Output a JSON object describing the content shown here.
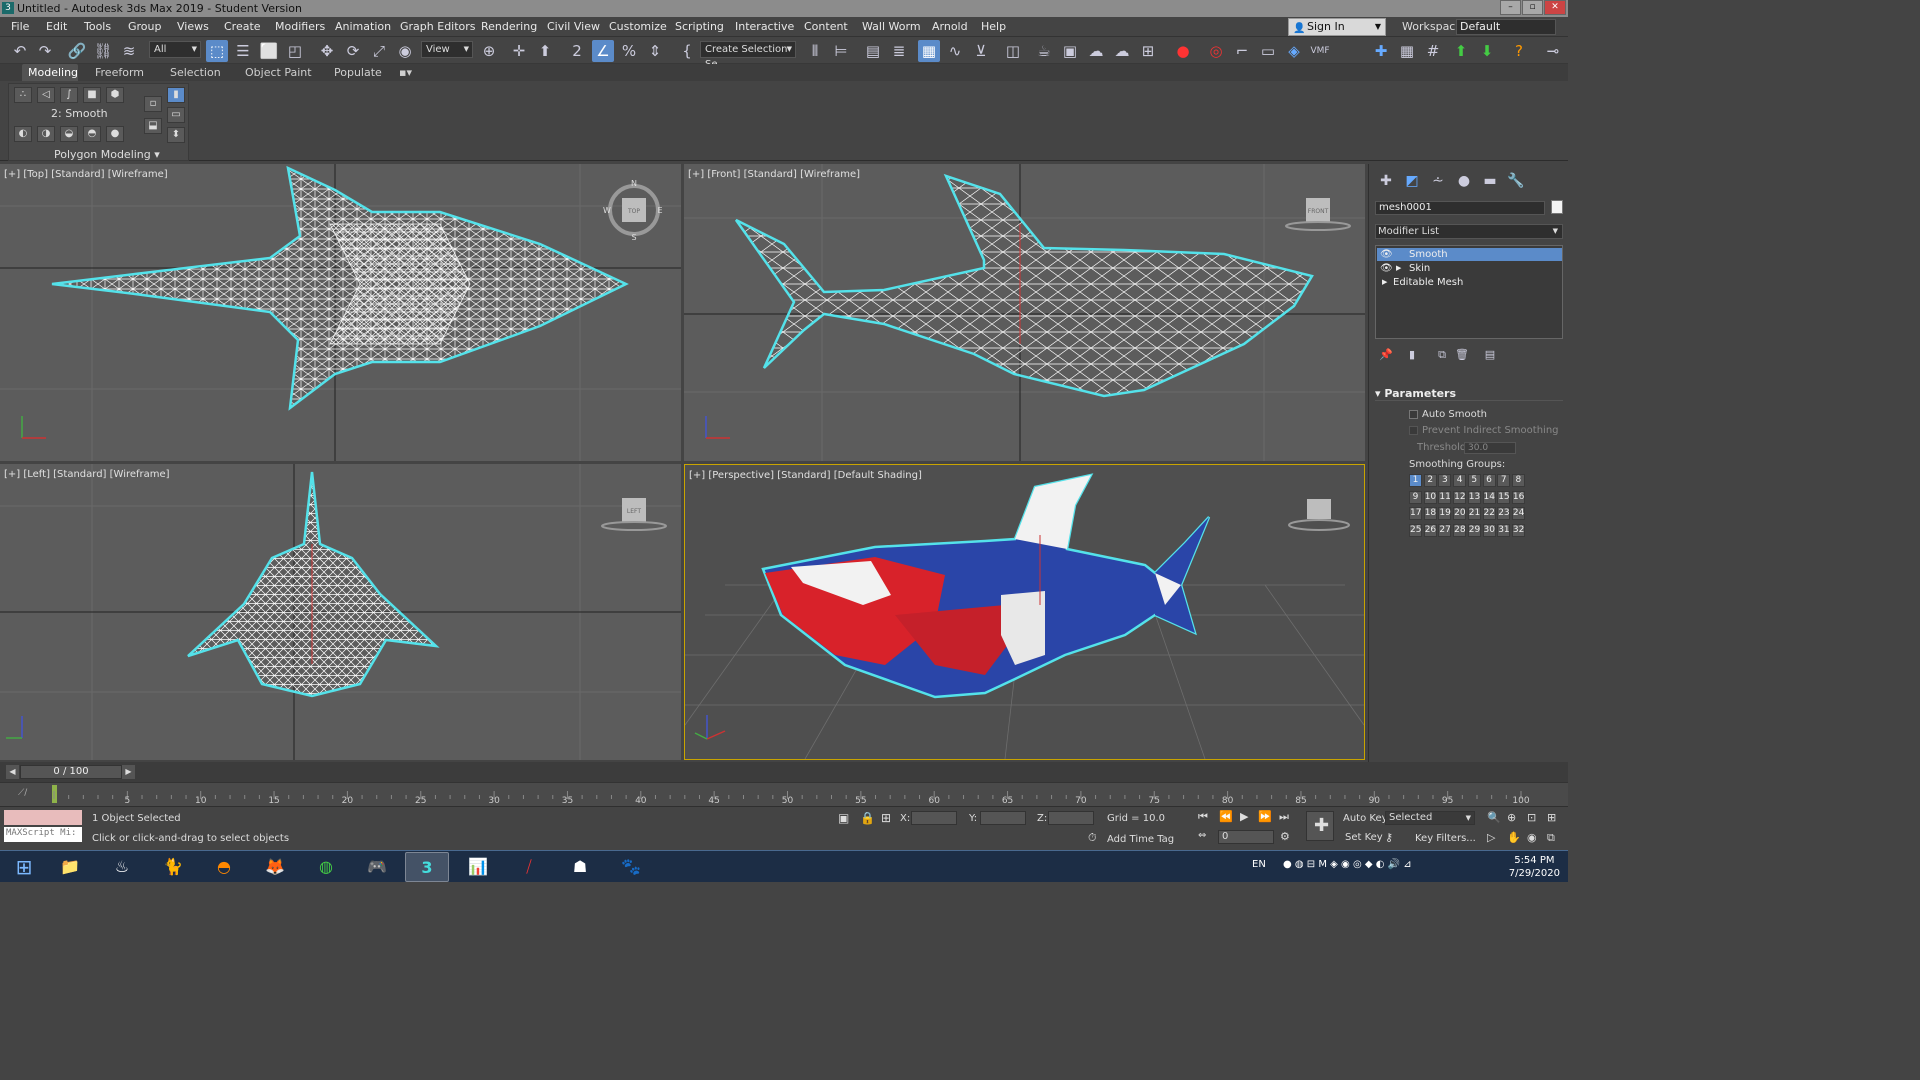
{
  "window": {
    "title": "Untitled - Autodesk 3ds Max 2019 - Student Version"
  },
  "menu": [
    "File",
    "Edit",
    "Tools",
    "Group",
    "Views",
    "Create",
    "Modifiers",
    "Animation",
    "Graph Editors",
    "Rendering",
    "Civil View",
    "Customize",
    "Scripting",
    "Interactive",
    "Content",
    "Wall Worm",
    "Arnold",
    "Help"
  ],
  "account": {
    "sign_in": "Sign In",
    "workspaces_label": "Workspaces:",
    "workspace": "Default"
  },
  "toolbar": {
    "filter": "All",
    "refcoord": "View",
    "selection_set": "Create Selection Se"
  },
  "ribbon": {
    "tabs": [
      "Modeling",
      "Freeform",
      "Selection",
      "Object Paint",
      "Populate"
    ],
    "level": "2: Smooth",
    "panel": "Polygon Modeling"
  },
  "viewports": {
    "top": "[+] [Top] [Standard] [Wireframe]",
    "front": "[+] [Front] [Standard] [Wireframe]",
    "left": "[+] [Left] [Standard] [Wireframe]",
    "perspective": "[+] [Perspective] [Standard] [Default Shading]"
  },
  "viewcube": {
    "top": "TOP",
    "front": "FRONT",
    "left": "LEFT",
    "n": "N",
    "s": "S",
    "e": "E",
    "w": "W"
  },
  "colors": {
    "selection": "#54e2ea",
    "accent": "#5b8bc9",
    "shark_blue": "#2a45a8",
    "shark_red": "#d8222a",
    "shark_white": "#f2f2f2",
    "active_border": "#c9a400"
  },
  "command_panel": {
    "object_name": "mesh0001",
    "modifier_list": "Modifier List",
    "stack": [
      "Smooth",
      "Skin",
      "Editable Mesh"
    ],
    "rollout": "Parameters",
    "auto_smooth": "Auto Smooth",
    "prevent": "Prevent Indirect Smoothing",
    "threshold_label": "Threshold:",
    "threshold_value": "30.0",
    "groups_label": "Smoothing Groups:",
    "groups": [
      "1",
      "2",
      "3",
      "4",
      "5",
      "6",
      "7",
      "8",
      "9",
      "10",
      "11",
      "12",
      "13",
      "14",
      "15",
      "16",
      "17",
      "18",
      "19",
      "20",
      "21",
      "22",
      "23",
      "24",
      "25",
      "26",
      "27",
      "28",
      "29",
      "30",
      "31",
      "32"
    ],
    "active_group": "1"
  },
  "timeline": {
    "frame": "0 / 100",
    "ticks": [
      "5",
      "10",
      "15",
      "20",
      "25",
      "30",
      "35",
      "40",
      "45",
      "50",
      "55",
      "60",
      "65",
      "70",
      "75",
      "80",
      "85",
      "90",
      "95",
      "100"
    ]
  },
  "status": {
    "selected": "1 Object Selected",
    "hint": "Click or click-and-drag to select objects",
    "maxscript": "MAXScript Mi:",
    "x": "X:",
    "y": "Y:",
    "z": "Z:",
    "grid": "Grid = 10.0",
    "add_time_tag": "Add Time Tag",
    "auto_key": "Auto Key",
    "set_key": "Set Key",
    "key_mode": "Selected",
    "key_filters": "Key Filters...",
    "frame_value": "0"
  },
  "taskbar": {
    "lang": "EN",
    "time": "5:54 PM",
    "date": "7/29/2020",
    "active_app": "3"
  }
}
